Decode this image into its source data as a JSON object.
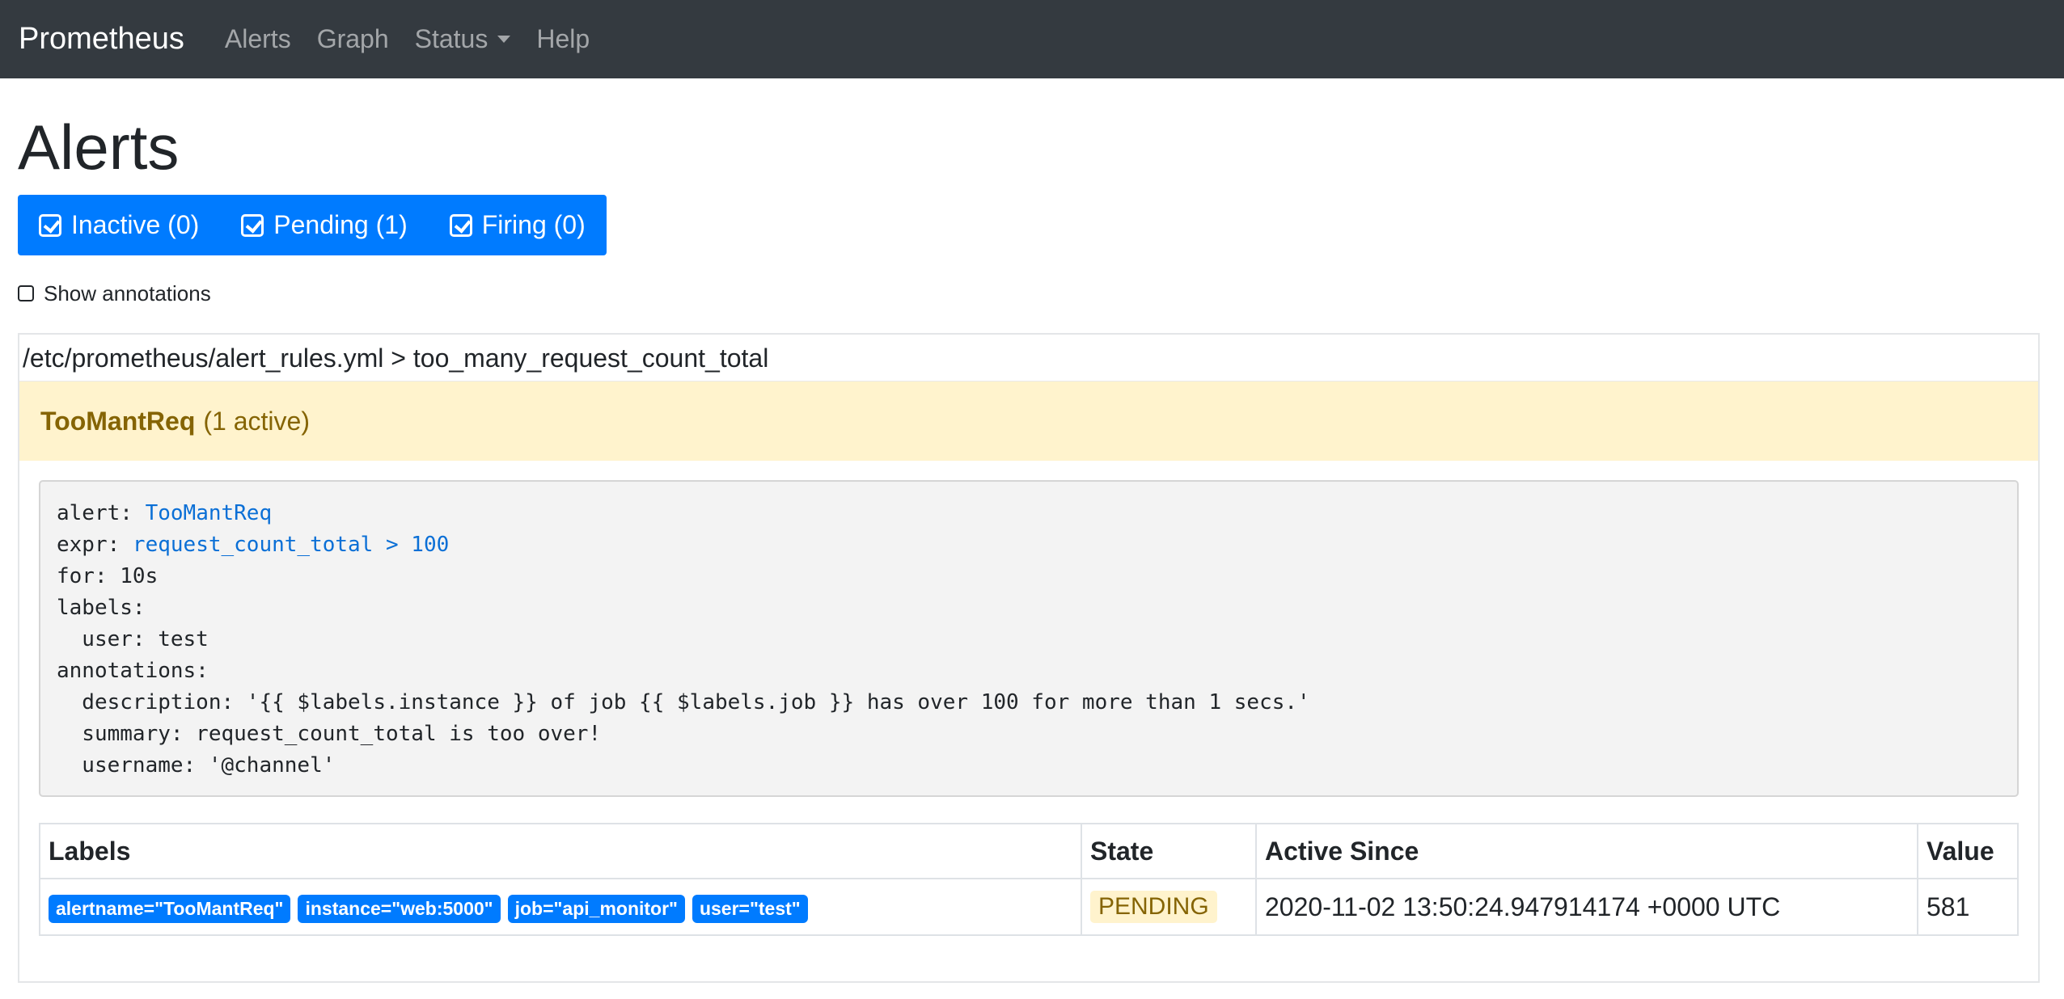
{
  "navbar": {
    "brand": "Prometheus",
    "links": [
      "Alerts",
      "Graph",
      "Status",
      "Help"
    ]
  },
  "page": {
    "title": "Alerts"
  },
  "filters": {
    "inactive": "Inactive (0)",
    "pending": "Pending (1)",
    "firing": "Firing (0)"
  },
  "show_annotations": {
    "label": "Show annotations",
    "checked": false
  },
  "group": {
    "header": "/etc/prometheus/alert_rules.yml > too_many_request_count_total",
    "alert_name": "TooMantReq",
    "active_count": "(1 active)"
  },
  "rule": {
    "alert_key": "alert: ",
    "alert_value": "TooMantReq",
    "expr_key": "expr: ",
    "expr_value": "request_count_total > 100",
    "rest": "for: 10s\nlabels:\n  user: test\nannotations:\n  description: '{{ $labels.instance }} of job {{ $labels.job }} has over 100 for more than 1 secs.'\n  summary: request_count_total is too over!\n  username: '@channel'"
  },
  "table": {
    "headers": [
      "Labels",
      "State",
      "Active Since",
      "Value"
    ],
    "rows": [
      {
        "labels": [
          "alertname=\"TooMantReq\"",
          "instance=\"web:5000\"",
          "job=\"api_monitor\"",
          "user=\"test\""
        ],
        "state": "PENDING",
        "active_since": "2020-11-02 13:50:24.947914174 +0000 UTC",
        "value": "581"
      }
    ]
  },
  "colors": {
    "navbar_bg": "#343a40",
    "primary": "#007bff",
    "warning_bg": "#fff3cd",
    "warning_text": "#856404"
  }
}
